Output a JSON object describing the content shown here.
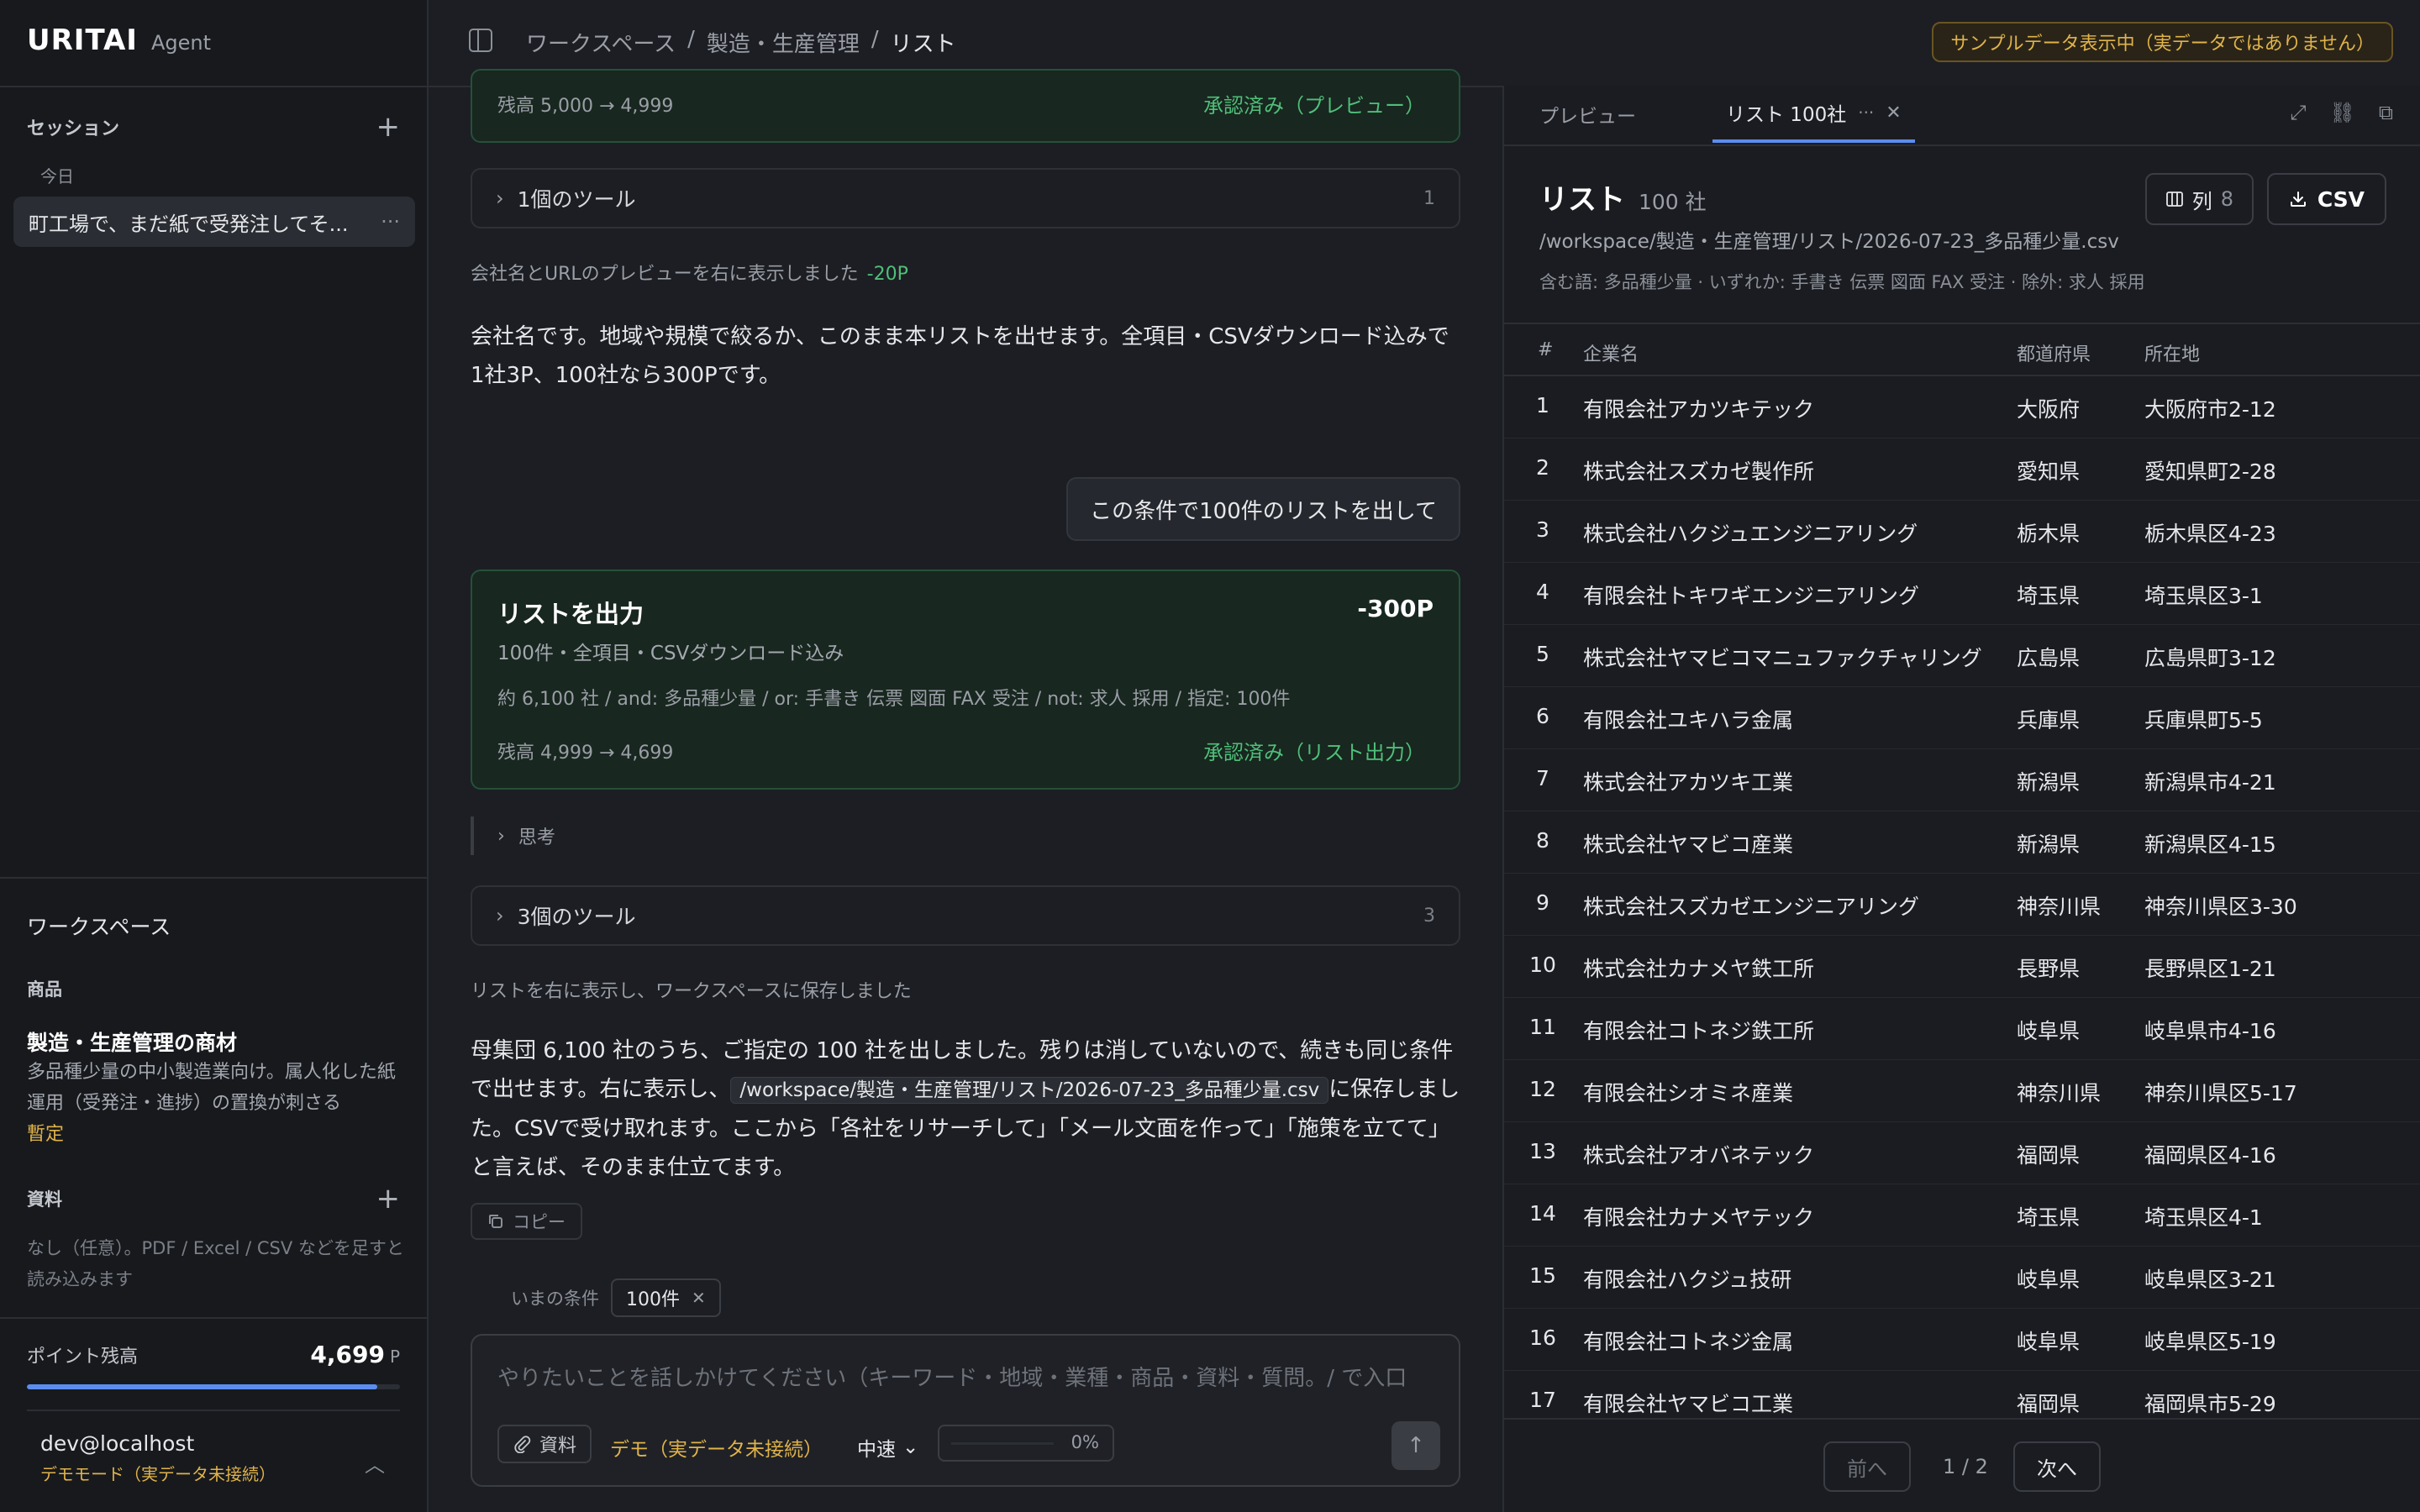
{
  "brand": {
    "logo": "URITAI",
    "sub": "Agent"
  },
  "sidebar": {
    "sessions_label": "セッション",
    "today_label": "今日",
    "session_item": "町工場で、まだ紙で受発注してそ...",
    "workspace_label": "ワークスペース",
    "product_label": "商品",
    "product_name": "製造・生産管理の商材",
    "product_desc": "多品種少量の中小製造業向け。属人化した紙運用（受発注・進捗）の置換が刺さる",
    "product_tag": "暫定",
    "materials_label": "資料",
    "materials_desc": "なし（任意）。PDF / Excel / CSV などを足すと読み込みます",
    "points_label": "ポイント残高",
    "points_value": "4,699",
    "points_unit": "P",
    "points_fill_fraction": 0.94,
    "user_name": "dev@localhost",
    "user_mode": "デモモード（実データ未接続）"
  },
  "topbar": {
    "crumbs": [
      "ワークスペース",
      "/",
      "製造・生産管理",
      "/",
      "リスト"
    ],
    "notice": "サンプルデータ表示中（実データではありません）"
  },
  "chat": {
    "card1_balance": "残高 5,000 → 4,999",
    "card1_status": "承認済み（プレビュー）",
    "tool1_label": "1個のツール",
    "tool1_count": "1",
    "note1": "会社名とURLのプレビューを右に表示しました",
    "note1_points": "-20P",
    "para1": "会社名です。地域や規模で絞るか、このまま本リストを出せます。全項目・CSVダウンロード込みで1社3P、100社なら300Pです。",
    "user_msg": "この条件で100件のリストを出して",
    "out_title": "リストを出力",
    "out_cost": "-300P",
    "out_sub": "100件・全項目・CSVダウンロード込み",
    "out_cond": "約 6,100 社 / and: 多品種少量 / or: 手書き 伝票 図面 FAX 受注 / not: 求人 採用 / 指定: 100件",
    "out_balance": "残高 4,999 → 4,699",
    "out_status": "承認済み（リスト出力）",
    "think_label": "思考",
    "tool2_label": "3個のツール",
    "tool2_count": "3",
    "note2": "リストを右に表示し、ワークスペースに保存しました",
    "para2_a": "母集団 6,100 社のうち、ご指定の 100 社を出しました。残りは消していないので、続きも同じ条件で出せます。右に表示し、",
    "para2_code": "/workspace/製造・生産管理/リスト/2026-07-23_多品種少量.csv",
    "para2_b": "に保存しました。CSVで受け取れます。ここから「各社をリサーチして」「メール文面を作って」「施策を立てて」と言えば、そのまま仕立てます。",
    "copy_label": "コピー",
    "cond_label": "いまの条件",
    "cond_chip": "100件",
    "placeholder": "やりたいことを話しかけてください（キーワード・地域・業種・商品・資料・質問。/ で入口",
    "attach_label": "資料",
    "demo_label": "デモ（実データ未接続）",
    "speed_label": "中速",
    "progress_pct": "0%",
    "progress_fraction": 0
  },
  "panel": {
    "tab_preview": "プレビュー",
    "tab_list": "リスト 100社",
    "list_title": "リスト",
    "list_count": "100 社",
    "list_path": "/workspace/製造・生産管理/リスト/2026-07-23_多品種少量.csv",
    "list_filter": "含む語: 多品種少量 · いずれか: 手書き 伝票 図面 FAX 受注 · 除外: 求人 採用",
    "col_label": "列",
    "col_count": "8",
    "csv_label": "CSV",
    "headers": [
      "#",
      "企業名",
      "都道府県",
      "所在地"
    ],
    "rows": [
      [
        "1",
        "有限会社アカツキテック",
        "大阪府",
        "大阪府市2-12"
      ],
      [
        "2",
        "株式会社スズカゼ製作所",
        "愛知県",
        "愛知県町2-28"
      ],
      [
        "3",
        "株式会社ハクジュエンジニアリング",
        "栃木県",
        "栃木県区4-23"
      ],
      [
        "4",
        "有限会社トキワギエンジニアリング",
        "埼玉県",
        "埼玉県区3-1"
      ],
      [
        "5",
        "株式会社ヤマビコマニュファクチャリング",
        "広島県",
        "広島県町3-12"
      ],
      [
        "6",
        "有限会社ユキハラ金属",
        "兵庫県",
        "兵庫県町5-5"
      ],
      [
        "7",
        "株式会社アカツキ工業",
        "新潟県",
        "新潟県市4-21"
      ],
      [
        "8",
        "株式会社ヤマビコ産業",
        "新潟県",
        "新潟県区4-15"
      ],
      [
        "9",
        "株式会社スズカゼエンジニアリング",
        "神奈川県",
        "神奈川県区3-30"
      ],
      [
        "10",
        "株式会社カナメヤ鉄工所",
        "長野県",
        "長野県区1-21"
      ],
      [
        "11",
        "有限会社コトネジ鉄工所",
        "岐阜県",
        "岐阜県市4-16"
      ],
      [
        "12",
        "有限会社シオミネ産業",
        "神奈川県",
        "神奈川県区5-17"
      ],
      [
        "13",
        "株式会社アオバネテック",
        "福岡県",
        "福岡県区4-16"
      ],
      [
        "14",
        "有限会社カナメヤテック",
        "埼玉県",
        "埼玉県区4-1"
      ],
      [
        "15",
        "有限会社ハクジュ技研",
        "岐阜県",
        "岐阜県区3-21"
      ],
      [
        "16",
        "有限会社コトネジ金属",
        "岐阜県",
        "岐阜県区5-19"
      ],
      [
        "17",
        "有限会社ヤマビコ工業",
        "福岡県",
        "福岡県市5-29"
      ]
    ],
    "prev_label": "前へ",
    "page_info": "1 / 2",
    "next_label": "次へ"
  }
}
